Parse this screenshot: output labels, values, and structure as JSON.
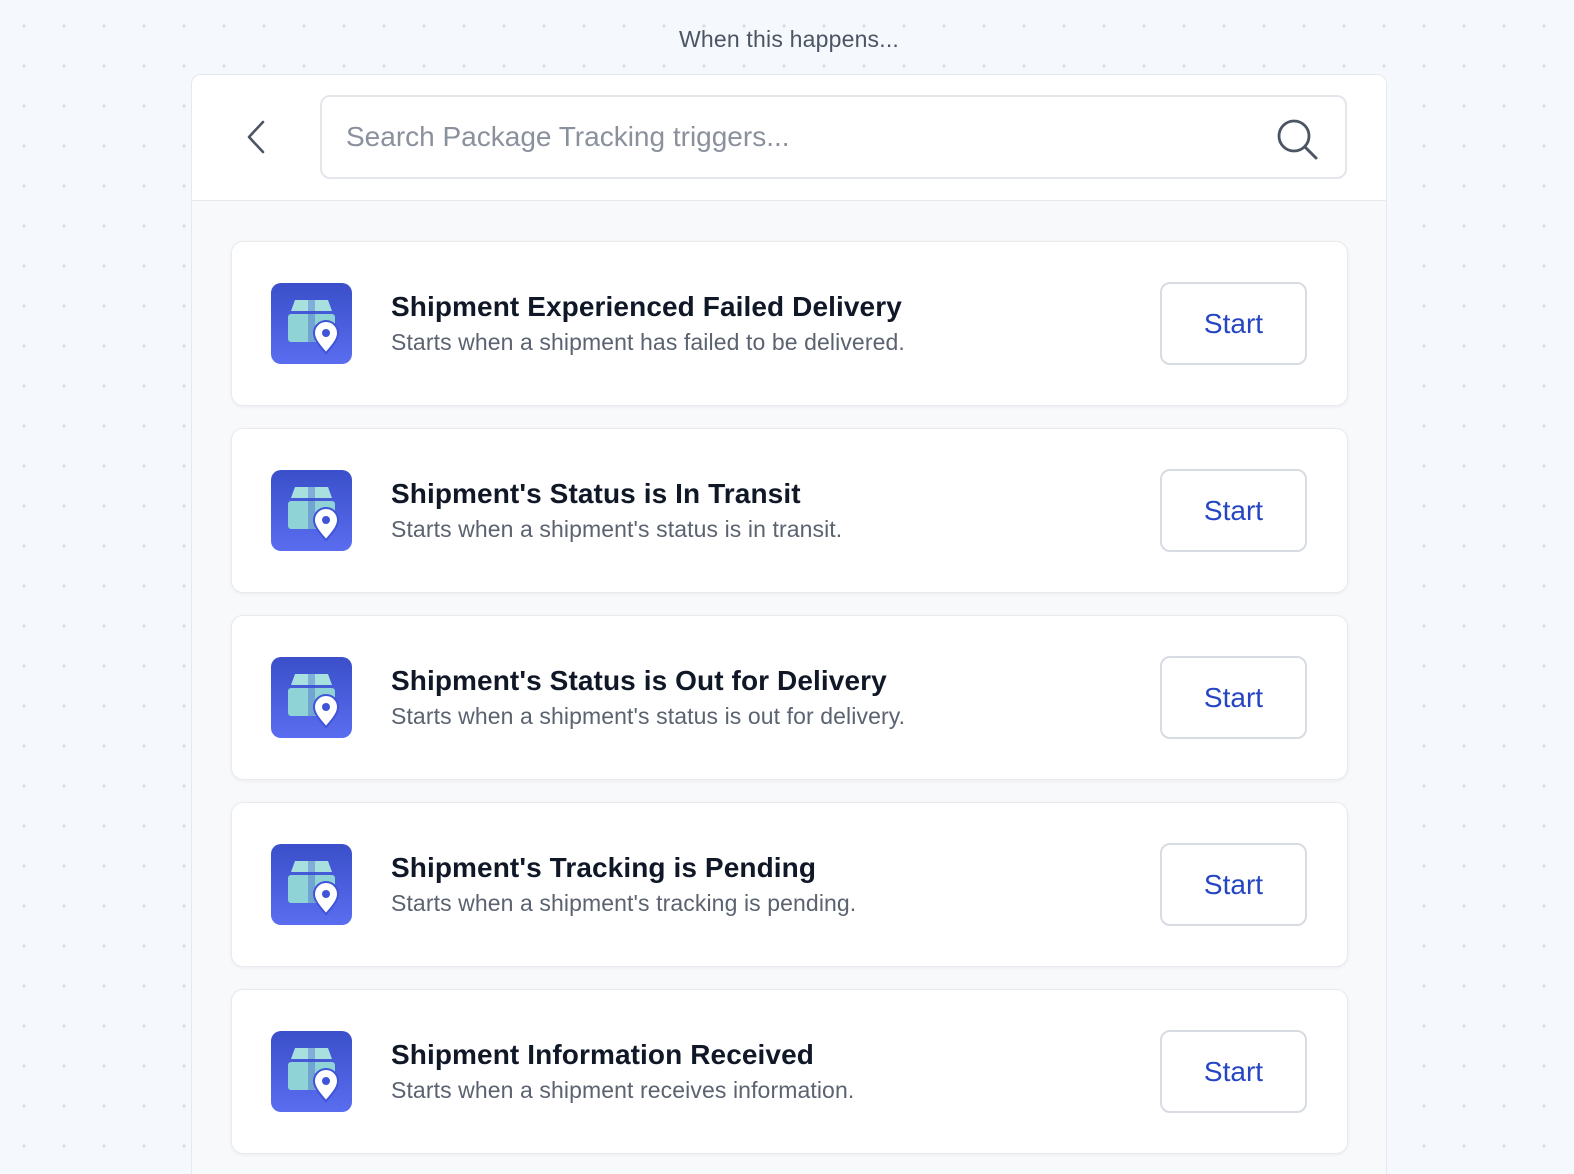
{
  "page": {
    "heading": "When this happens..."
  },
  "search": {
    "placeholder": "Search Package Tracking triggers...",
    "value": ""
  },
  "icons": {
    "back": "chevron-left-icon",
    "search": "magnifier-icon",
    "app": "package-tracking-app-icon"
  },
  "colors": {
    "accent": "#2545c2",
    "app_icon_gradient_top": "#3a4fc9",
    "app_icon_gradient_bottom": "#5a6df0",
    "app_icon_box": "#8fd3d6"
  },
  "triggers": [
    {
      "title": "Shipment Experienced Failed Delivery",
      "description": "Starts when a shipment has failed to be delivered.",
      "button": "Start"
    },
    {
      "title": "Shipment's Status is In Transit",
      "description": "Starts when a shipment's status is in transit.",
      "button": "Start"
    },
    {
      "title": "Shipment's Status is Out for Delivery",
      "description": "Starts when a shipment's status is out for delivery.",
      "button": "Start"
    },
    {
      "title": "Shipment's Tracking is Pending",
      "description": "Starts when a shipment's tracking is pending.",
      "button": "Start"
    },
    {
      "title": "Shipment Information Received",
      "description": "Starts when a shipment receives information.",
      "button": "Start"
    }
  ]
}
